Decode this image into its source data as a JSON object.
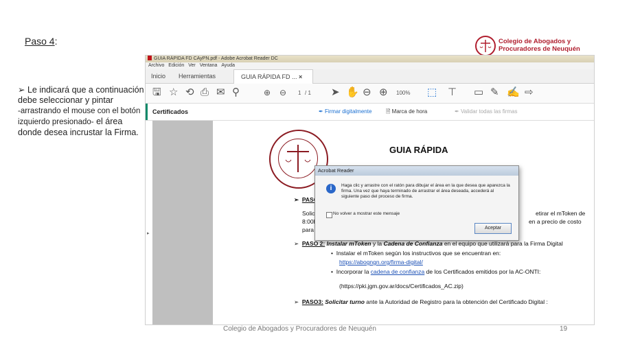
{
  "slide": {
    "heading_word": "Paso 4",
    "heading_suffix": ":",
    "bullet_main": "Le indicará que a continuación debe seleccionar y pintar",
    "bullet_detail": "-arrastrando el mouse con el botón izquierdo presionado-",
    "bullet_end": "el área donde desea incrustar la Firma.",
    "logo_line1": "Colegio de Abogados y",
    "logo_line2": "Procuradores de Neuquén",
    "footer": "Colegio de Abogados y Procuradores de Neuquén",
    "page_number": "19"
  },
  "reader": {
    "window_title": "GUIA RÁPIDA FD CAyPN.pdf - Adobe Acrobat Reader DC",
    "menu": [
      "Archivo",
      "Edición",
      "Ver",
      "Ventana",
      "Ayuda"
    ],
    "tabs": {
      "home": "Inicio",
      "tools": "Herramientas",
      "doc": "GUIA RÁPIDA FD ...",
      "close": "×"
    },
    "toolbar": {
      "page_current": "1",
      "page_total": "/ 1",
      "zoom": "100%"
    },
    "cert_bar": {
      "label": "Certificados",
      "sign": "Firmar digitalmente",
      "timestamp": "Marca de hora",
      "validate": "Validar todas las firmas"
    },
    "doc": {
      "title": "GUIA RÁPIDA",
      "paso1": "PASO 1",
      "solicitar": "Solicitar",
      "retirar": "etirar el mToken de",
      "hours": "8:00hs",
      "precio": "en a precio de costo",
      "matriculados": "para todos los matriculados.",
      "paso2_label": "PASO 2:",
      "paso2_a": "Instalar mToken",
      "paso2_b": "y la",
      "paso2_c": "Cadena de Confianza",
      "paso2_d": "en el equipo que utilizará para la Firma Digital",
      "inst1": "Instalar el mToken según los instructivos que se encuentran en:",
      "link1": "https://abogngn.org/firma-digital/",
      "inst2_a": "Incorporar la",
      "inst2_link": "cadena de confianza",
      "inst2_b": "de los Certificados emitidos por la AC-ONTI:",
      "url2": "(https://pki.jgm.gov.ar/docs/Certificados_AC.zip)",
      "paso3_label": "PASO3:",
      "paso3_a": "Solicitar turno",
      "paso3_b": "ante la Autoridad de Registro para la obtención del Certificado Digital :"
    },
    "dialog": {
      "title": "Acrobat Reader",
      "message": "Haga clic y arrastre con el ratón para dibujar el área en la que desea que aparezca la firma. Una vez que haya terminado de arrastrar el área deseada, accederá al siguiente paso del proceso de firma.",
      "checkbox": "No volver a mostrar este mensaje",
      "button": "Aceptar"
    }
  }
}
